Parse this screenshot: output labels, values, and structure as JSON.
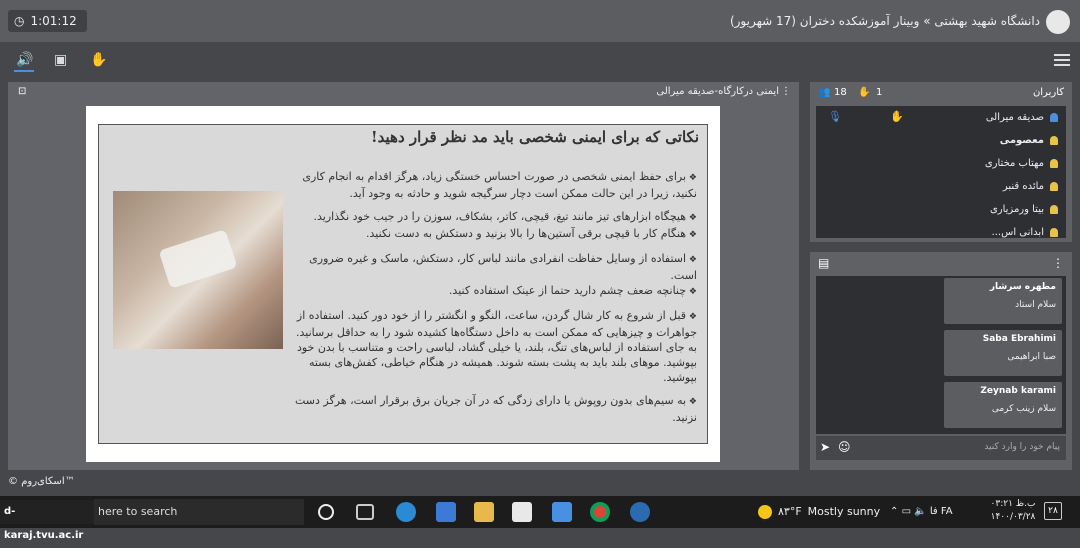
{
  "header": {
    "timer": "1:01:12",
    "room_title": "دانشگاه شهید بهشتی » وبینار آموزشکده دختران (17 شهریور)"
  },
  "document": {
    "title": "ایمنی درکارگاه-صدیقه میرالی",
    "slide_heading": "نکاتی که برای ایمنی شخصی باید مد نظر قرار دهید!",
    "paragraphs": [
      "برای حفظ ایمنی شخصی در صورت احساس خستگی زیاد، هرگز اقدام به انجام کاری نکنید، زیرا در این حالت ممکن است دچار سرگیجه شوید و حادثه به وجود آید.",
      "هیچگاه ابزارهای تیز مانند تیغ، قیچی، کاتر، بشکاف، سوزن را در جیب خود نگذارید.",
      "هنگام کار با قیچی برقی آستین‌ها را بالا بزنید و دستکش به دست نکنید.",
      "استفاده از وسایل حفاظت انفرادی مانند لباس کار، دستکش، ماسک و غیره ضروری است.",
      "چنانچه ضعف چشم دارید حتما از عینک استفاده کنید.",
      "قبل از شروع به کار شال گردن، ساعت، النگو و انگشتر را از خود دور کنید. استفاده از جواهرات و چیزهایی که ممکن است به داخل دستگاه‌ها کشیده شود را به حداقل برسانید. به جای استفاده از لباس‌های تنگ، بلند، یا خیلی گشاد، لباسی راحت و متناسب با بدن خود بپوشید. موهای بلند باید به پشت بسته شوند. همیشه در هنگام خیاطی، کفش‌های بسته بپوشید.",
      "به سیم‌های بدون روپوش یا دارای زدگی که در آن جریان برق برقرار است، هرگز دست نزنید."
    ]
  },
  "users": {
    "title": "کاربران",
    "count": "18",
    "raised_hands": "1",
    "list": [
      "صدیقه میرالی",
      "معصومی",
      "مهتاب مختاری",
      "مائده قنبر",
      "بیتا ورمزیاری",
      "ابدانی اس..."
    ]
  },
  "chat": {
    "messages": [
      {
        "name": "مطهره سرشار",
        "text": "سلام استاد"
      },
      {
        "name": "Saba Ebrahimi",
        "text": "صبا ابراهیمی"
      },
      {
        "name": "Zeynab karami",
        "text": "سلام زینب کرمی"
      }
    ],
    "placeholder": "پیام خود را وارد کنید"
  },
  "footer": {
    "brand": "© اسکای‌روم™"
  },
  "taskbar": {
    "logo": "d-karaj.tvu.ac.ir",
    "search": "here to search",
    "temperature": "۸۳°F",
    "weather": "Mostly sunny",
    "lang": "FA",
    "ime": "فا",
    "time": "ب.ظ ۰۳:۲۱",
    "date": "۱۴۰۰/۰۳/۲۸",
    "notifications": "۲۸"
  },
  "colors": {
    "accent": "#4a90e2",
    "panel": "#5f6165",
    "dark": "#2d2f33"
  }
}
